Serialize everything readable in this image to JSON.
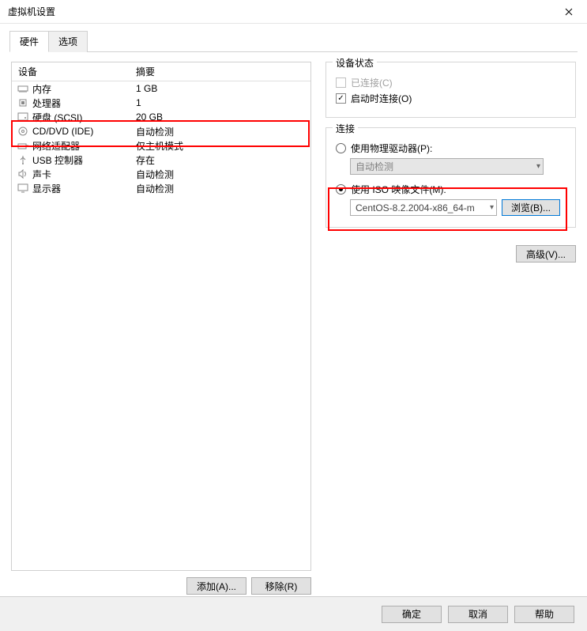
{
  "window": {
    "title": "虚拟机设置"
  },
  "tabs": {
    "hardware": "硬件",
    "options": "选项"
  },
  "list": {
    "header_device": "设备",
    "header_summary": "摘要",
    "rows": [
      {
        "name": "内存",
        "summary": "1 GB",
        "icon": "memory"
      },
      {
        "name": "处理器",
        "summary": "1",
        "icon": "cpu"
      },
      {
        "name": "硬盘 (SCSI)",
        "summary": "20 GB",
        "icon": "disk"
      },
      {
        "name": "CD/DVD (IDE)",
        "summary": "自动检测",
        "icon": "cd"
      },
      {
        "name": "网络适配器",
        "summary": "仅主机模式",
        "icon": "nic"
      },
      {
        "name": "USB 控制器",
        "summary": "存在",
        "icon": "usb"
      },
      {
        "name": "声卡",
        "summary": "自动检测",
        "icon": "sound"
      },
      {
        "name": "显示器",
        "summary": "自动检测",
        "icon": "display"
      }
    ]
  },
  "left_buttons": {
    "add": "添加(A)...",
    "remove": "移除(R)"
  },
  "status": {
    "legend": "设备状态",
    "connected": "已连接(C)",
    "connect_at_poweron": "启动时连接(O)"
  },
  "connection": {
    "legend": "连接",
    "use_physical": "使用物理驱动器(P):",
    "auto_detect": "自动检测",
    "use_iso": "使用 ISO 映像文件(M):",
    "iso_value": "CentOS-8.2.2004-x86_64-m",
    "browse": "浏览(B)..."
  },
  "advanced": "高级(V)...",
  "bottom": {
    "ok": "确定",
    "cancel": "取消",
    "help": "帮助"
  }
}
